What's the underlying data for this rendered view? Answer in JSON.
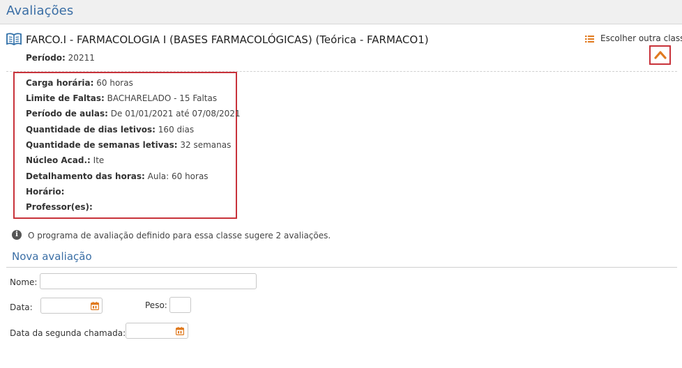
{
  "page": {
    "title": "Avaliações"
  },
  "class_info": {
    "title": "FARCO.I - FARMACOLOGIA I (BASES FARMACOLÓGICAS) (Teórica - FARMACO1)",
    "periodo_label": "Período:",
    "periodo_value": "20211",
    "choose_other_label": "Escolher outra classe"
  },
  "details": [
    {
      "label": "Carga horária:",
      "value": "60 horas"
    },
    {
      "label": "Limite de Faltas:",
      "value": "BACHARELADO - 15 Faltas"
    },
    {
      "label": "Período de aulas:",
      "value": "De 01/01/2021 até 07/08/2021"
    },
    {
      "label": "Quantidade de dias letivos:",
      "value": "160 dias"
    },
    {
      "label": "Quantidade de semanas letivas:",
      "value": "32 semanas"
    },
    {
      "label": "Núcleo Acad.:",
      "value": "Ite"
    },
    {
      "label": "Detalhamento das horas:",
      "value": "Aula: 60 horas"
    },
    {
      "label": "Horário:",
      "value": ""
    },
    {
      "label": "Professor(es):",
      "value": ""
    }
  ],
  "info_message": "O programa de avaliação definido para essa classe sugere 2 avaliações.",
  "new_evaluation": {
    "section_title": "Nova avaliação",
    "nome_label": "Nome:",
    "nome_value": "",
    "data_label": "Data:",
    "data_value": "",
    "peso_label": "Peso:",
    "peso_value": "",
    "segunda_chamada_label": "Data da segunda chamada:",
    "segunda_chamada_value": ""
  },
  "colors": {
    "accent": "#3a6ea5",
    "highlight_border": "#c8323a",
    "icon_orange": "#e07a1f"
  },
  "icons": {
    "book": "book-open-icon",
    "list": "list-icon",
    "collapse": "chevron-up-icon",
    "info": "info-icon",
    "calendar": "calendar-icon"
  }
}
